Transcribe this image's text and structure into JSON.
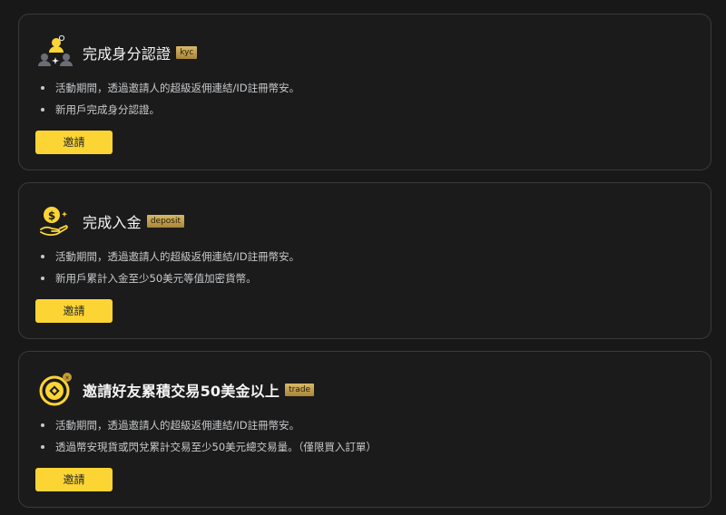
{
  "colors": {
    "accent": "#fcd535",
    "tag": "#c9a554",
    "card_border": "#3a3a3a",
    "background": "#181818"
  },
  "tasks": [
    {
      "icon": "kyc-users-icon",
      "title": "完成身分認證",
      "tag": "kyc",
      "bullets": [
        "活動期間，透過邀請人的超級返佣連結/ID註冊幣安。",
        "新用戶完成身分認證。"
      ],
      "button": "邀請"
    },
    {
      "icon": "deposit-coin-hand-icon",
      "title": "完成入金",
      "tag": "deposit",
      "bullets": [
        "活動期間，透過邀請人的超級返佣連結/ID註冊幣安。",
        "新用戶累計入金至少50美元等值加密貨幣。"
      ],
      "button": "邀請"
    },
    {
      "icon": "trade-coin-icon",
      "title": "邀請好友累積交易50美金以上",
      "tag": "trade",
      "bullets": [
        "活動期間，透過邀請人的超級返佣連結/ID註冊幣安。",
        "透過幣安現貨或閃兌累計交易至少50美元總交易量。（僅限買入訂單）"
      ],
      "button": "邀請"
    }
  ]
}
